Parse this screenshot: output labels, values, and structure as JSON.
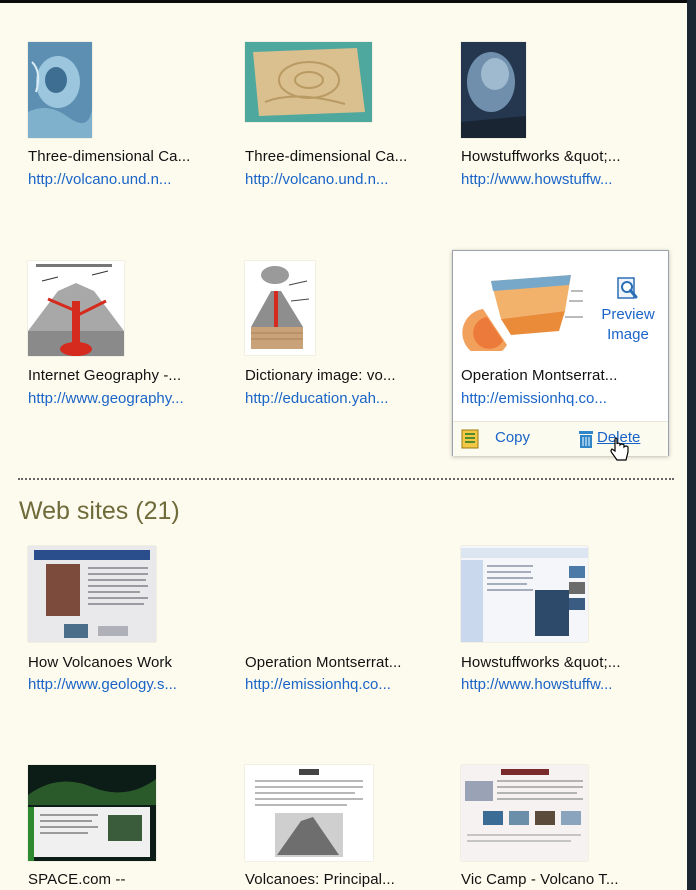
{
  "image_results": [
    {
      "title": "Three-dimensional Ca...",
      "url": "http://volcano.und.n..."
    },
    {
      "title": "Three-dimensional Ca...",
      "url": "http://volcano.und.n..."
    },
    {
      "title": "Howstuffworks &quot;...",
      "url": "http://www.howstuffw..."
    },
    {
      "title": "Internet Geography -...",
      "url": "http://www.geography..."
    },
    {
      "title": "Dictionary image: vo...",
      "url": "http://education.yah..."
    },
    {
      "title": "Operation Montserrat...",
      "url": "http://emissionhq.co..."
    }
  ],
  "hover_actions": {
    "preview": "Preview Image",
    "copy": "Copy",
    "delete": "Delete"
  },
  "web_section": {
    "title": "Web sites (21)"
  },
  "web_results": [
    {
      "title": "How Volcanoes Work",
      "url": "http://www.geology.s..."
    },
    {
      "title": "Operation Montserrat...",
      "url": "http://emissionhq.co..."
    },
    {
      "title": "Howstuffworks &quot;...",
      "url": "http://www.howstuffw..."
    },
    {
      "title": "SPACE.com --",
      "url": ""
    },
    {
      "title": "Volcanoes: Principal...",
      "url": ""
    },
    {
      "title": "Vic Camp - Volcano T...",
      "url": ""
    }
  ],
  "colors": {
    "background": "#fdfbee",
    "link": "#1a64c7",
    "section_title": "#6f6b3b"
  }
}
